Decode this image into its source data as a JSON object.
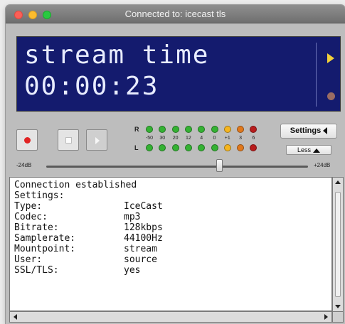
{
  "window": {
    "title": "Connected to: icecast tls"
  },
  "display": {
    "line1": "stream time",
    "line2": "00:00:23",
    "play_color": "#f2d13a",
    "status_color": "#9a6c63",
    "background": "#141b6e"
  },
  "transport": {
    "record_icon": "record-icon",
    "stop_icon": "stop-icon",
    "play_icon": "play-icon"
  },
  "meter": {
    "right_label": "R",
    "left_label": "L",
    "ticks": [
      "-50",
      "30",
      "20",
      "12",
      "4",
      "0",
      "+1",
      "3",
      "6"
    ],
    "led_colors": [
      "#34b233",
      "#34b233",
      "#34b233",
      "#34b233",
      "#34b233",
      "#34b233",
      "#f5b51f",
      "#e0781c",
      "#b81c1c"
    ]
  },
  "buttons": {
    "settings_label": "Settings",
    "less_label": "Less"
  },
  "volume": {
    "min_label": "-24dB",
    "max_label": "+24dB",
    "level": 0.66
  },
  "log": {
    "header": [
      "Connection established",
      "Settings:"
    ],
    "rows": [
      {
        "key": "Type:",
        "value": "IceCast"
      },
      {
        "key": "Codec:",
        "value": "mp3"
      },
      {
        "key": "Bitrate:",
        "value": "128kbps"
      },
      {
        "key": "Samplerate:",
        "value": "44100Hz"
      },
      {
        "key": "Mountpoint:",
        "value": "stream"
      },
      {
        "key": "User:",
        "value": "source"
      },
      {
        "key": "SSL/TLS:",
        "value": "yes"
      }
    ]
  }
}
